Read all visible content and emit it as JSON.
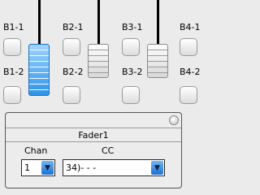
{
  "faders": {
    "row1": [
      "B1-1",
      "B2-1",
      "B3-1",
      "B4-1"
    ],
    "row2": [
      "B1-2",
      "B2-2",
      "B3-2",
      "B4-2"
    ]
  },
  "panel": {
    "title": "Fader1",
    "chan_label": "Chan",
    "cc_label": "CC",
    "chan_value": "1",
    "cc_value": "34)- - -"
  },
  "colors": {
    "active_fader": "#3a9bf0",
    "dropdown_arrow": "#2a7fdc"
  }
}
